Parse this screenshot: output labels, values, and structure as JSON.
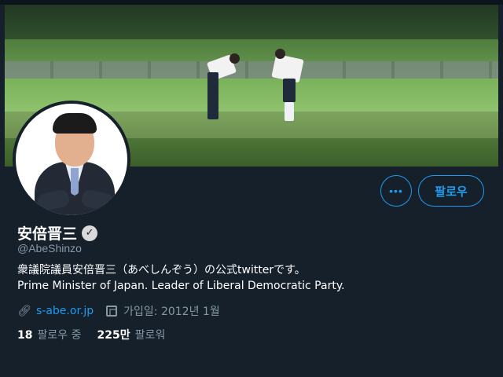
{
  "profile": {
    "name": "安倍晋三",
    "handle": "@AbeShinzo",
    "bio_line1": "衆議院議員安倍晋三（あべしんぞう）の公式twitterです。",
    "bio_line2": "Prime Minister of Japan. Leader of Liberal Democratic Party.",
    "website": "s-abe.or.jp",
    "joined": "가입일: 2012년 1월",
    "following_count": "18",
    "following_label": "팔로우 중",
    "followers_count": "225만",
    "followers_label": "팔로워"
  },
  "actions": {
    "more_label": "•••",
    "follow_label": "팔로우"
  },
  "icons": {
    "verified": "verified-badge-icon",
    "link": "link-icon",
    "calendar": "calendar-icon"
  },
  "colors": {
    "background": "#15202b",
    "accent": "#1d9bf0",
    "muted": "#8899a6"
  }
}
